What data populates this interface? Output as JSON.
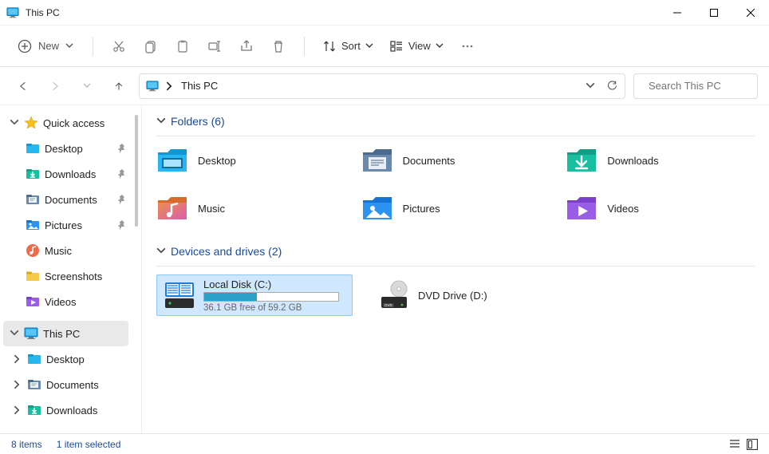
{
  "window": {
    "title": "This PC"
  },
  "toolbar": {
    "new_label": "New",
    "sort_label": "Sort",
    "view_label": "View"
  },
  "address": {
    "crumb": "This PC"
  },
  "search": {
    "placeholder": "Search This PC"
  },
  "sidebar": {
    "quick_access": {
      "label": "Quick access"
    },
    "qa_items": [
      {
        "label": "Desktop",
        "pin": true
      },
      {
        "label": "Downloads",
        "pin": true
      },
      {
        "label": "Documents",
        "pin": true
      },
      {
        "label": "Pictures",
        "pin": true
      },
      {
        "label": "Music",
        "pin": false
      },
      {
        "label": "Screenshots",
        "pin": false
      },
      {
        "label": "Videos",
        "pin": false
      }
    ],
    "this_pc": {
      "label": "This PC"
    },
    "pc_children": [
      {
        "label": "Desktop"
      },
      {
        "label": "Documents"
      },
      {
        "label": "Downloads"
      }
    ]
  },
  "sections": {
    "folders": {
      "heading": "Folders (6)"
    },
    "drives": {
      "heading": "Devices and drives (2)"
    }
  },
  "folders": [
    {
      "label": "Desktop"
    },
    {
      "label": "Documents"
    },
    {
      "label": "Downloads"
    },
    {
      "label": "Music"
    },
    {
      "label": "Pictures"
    },
    {
      "label": "Videos"
    }
  ],
  "drives": {
    "c": {
      "name": "Local Disk (C:)",
      "free_text": "36.1 GB free of 59.2 GB",
      "used_pct": 39
    },
    "d": {
      "name": "DVD Drive (D:)"
    }
  },
  "status": {
    "items": "8 items",
    "selection": "1 item selected"
  },
  "colors": {
    "accent_blue": "#1a4aa0",
    "selection_bg": "#cfe8ff",
    "selection_border": "#8cc7ff",
    "drive_bar_fill": "#2aa0c8"
  }
}
